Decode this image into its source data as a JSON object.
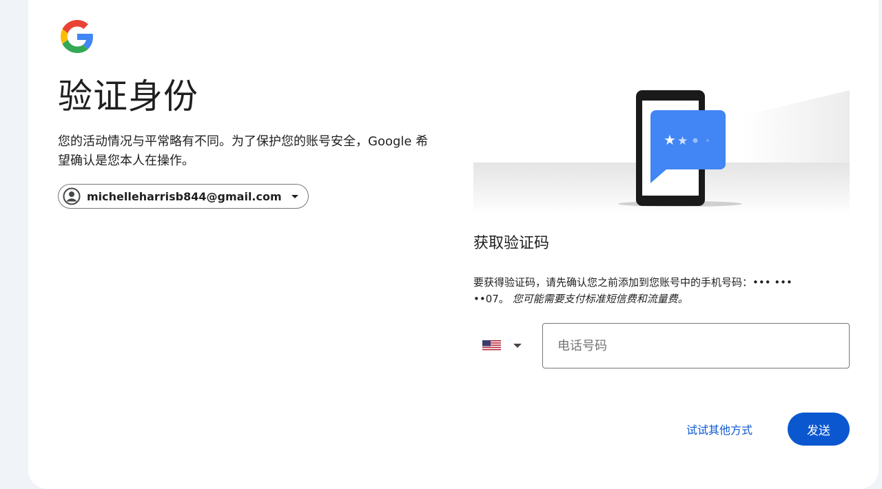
{
  "header": {
    "logo_icon": "google-g-logo-icon",
    "title": "验证身份",
    "subtitle": "您的活动情况与平常略有不同。为了保护您的账号安全，Google 希望确认是您本人在操作。"
  },
  "account": {
    "avatar_icon": "account-circle-icon",
    "email": "michelleharrisb844@gmail.com",
    "dropdown_icon": "caret-down-icon"
  },
  "illustration": {
    "icon": "phone-sms-code-illustration"
  },
  "verify": {
    "title": "获取验证码",
    "description": "要获得验证码，请先确认您之前添加到您账号中的手机号码：••• ••• ••07。",
    "note": "您可能需要支付标准短信费和流量费。"
  },
  "phone_input": {
    "country_flag_icon": "us-flag-icon",
    "country_dropdown_icon": "caret-down-icon",
    "placeholder": "电话号码",
    "value": ""
  },
  "actions": {
    "try_another_label": "试试其他方式",
    "send_label": "发送"
  },
  "colors": {
    "background": "#f0f4f9",
    "card": "#ffffff",
    "primary": "#0b57d0",
    "text": "#1f1f1f",
    "outline": "#747775",
    "illustration_blue": "#4285f4"
  }
}
